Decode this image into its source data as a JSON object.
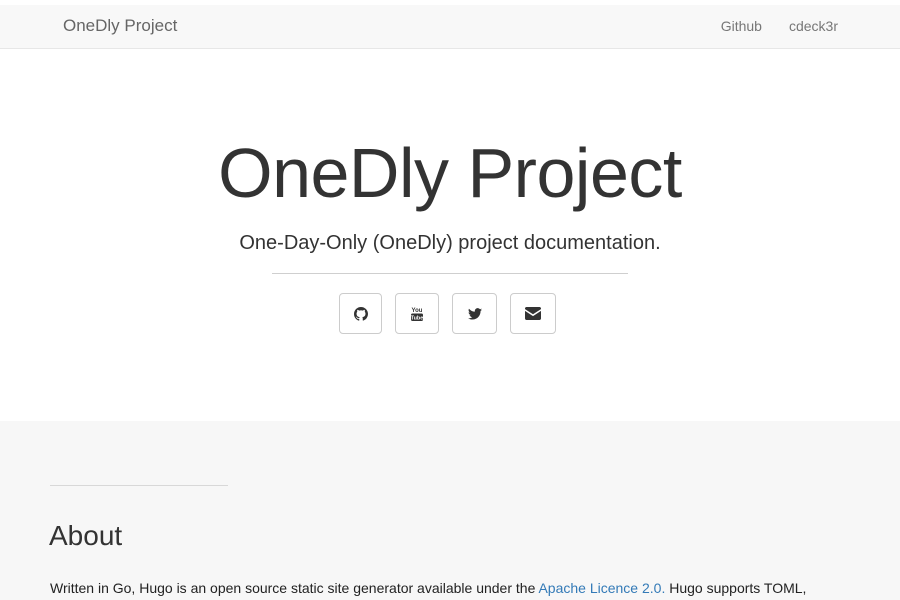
{
  "navbar": {
    "brand": "OneDly Project",
    "links": [
      "Github",
      "cdeck3r"
    ]
  },
  "hero": {
    "title": "OneDly Project",
    "subtitle": "One-Day-Only (OneDly) project documentation.",
    "social": [
      {
        "icon": "github-icon"
      },
      {
        "icon": "youtube-icon"
      },
      {
        "icon": "twitter-icon"
      },
      {
        "icon": "envelope-icon"
      }
    ]
  },
  "about": {
    "title": "About",
    "text_before": "Written in Go, Hugo is an open source static site generator available under the ",
    "link_text": "Apache Licence 2.0.",
    "text_after": " Hugo supports TOML,"
  },
  "colors": {
    "link": "#337ab7",
    "navbar_bg": "#f8f8f8",
    "about_bg": "#f7f7f7"
  }
}
